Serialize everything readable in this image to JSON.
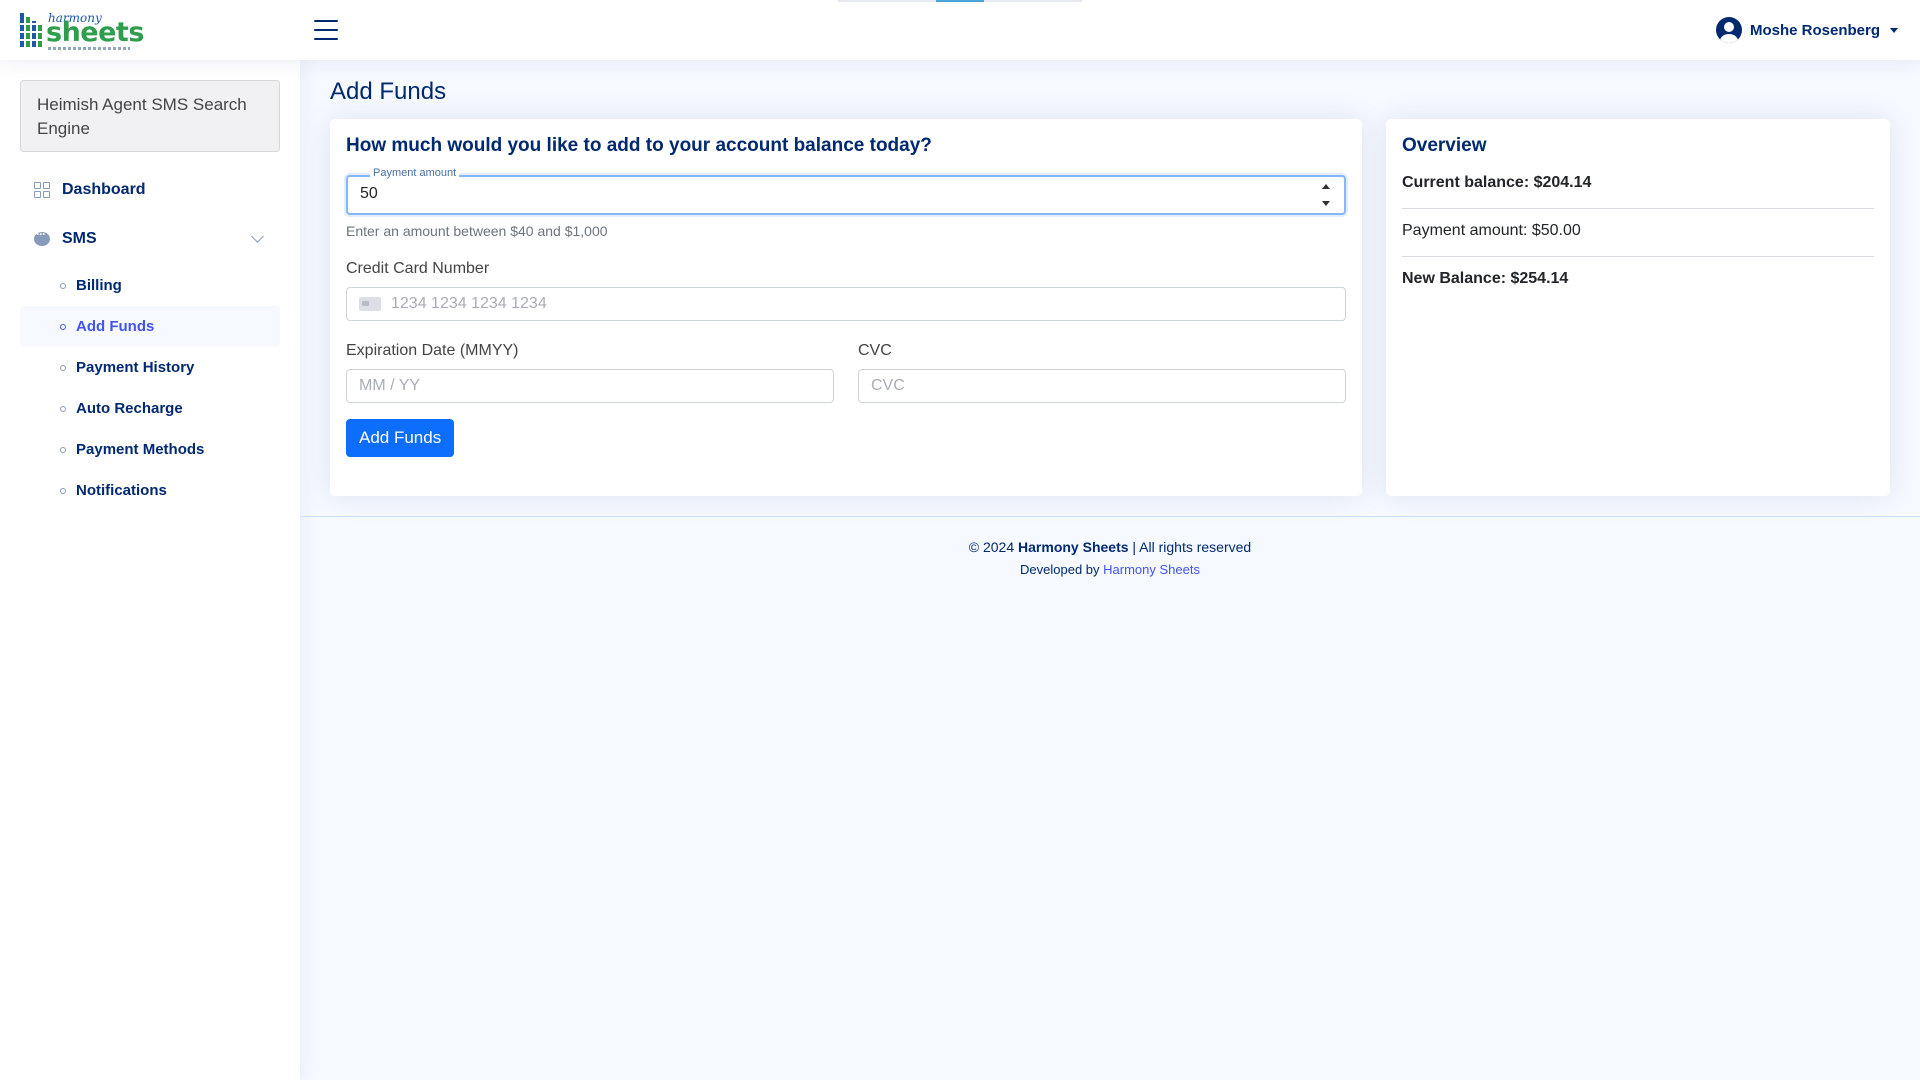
{
  "header": {
    "logo": {
      "small": "harmony",
      "big": "sheets"
    },
    "user_name": "Moshe Rosenberg"
  },
  "sidebar": {
    "app_name": "Heimish Agent SMS Search Engine",
    "items": [
      {
        "label": "Dashboard",
        "icon": "grid-icon"
      },
      {
        "label": "SMS",
        "icon": "chat-icon",
        "expanded": true
      }
    ],
    "sms_children": [
      {
        "label": "Billing"
      },
      {
        "label": "Add Funds",
        "active": true
      },
      {
        "label": "Payment History"
      },
      {
        "label": "Auto Recharge"
      },
      {
        "label": "Payment Methods"
      },
      {
        "label": "Notifications"
      }
    ]
  },
  "main": {
    "page_title": "Add Funds",
    "form": {
      "question": "How much would you like to add to your account balance today?",
      "amount_label": "Payment amount",
      "amount_value": "50",
      "amount_help": "Enter an amount between $40 and $1,000",
      "cc_label": "Credit Card Number",
      "cc_placeholder": "1234 1234 1234 1234",
      "exp_label": "Expiration Date (MMYY)",
      "exp_placeholder": "MM / YY",
      "cvc_label": "CVC",
      "cvc_placeholder": "CVC",
      "submit_label": "Add Funds"
    },
    "overview": {
      "title": "Overview",
      "current_balance": "Current balance: $204.14",
      "payment_amount": "Payment amount: $50.00",
      "new_balance": "New Balance: $254.14"
    }
  },
  "footer": {
    "copyright_prefix": "© 2024",
    "brand": "Harmony Sheets",
    "rights": "| All rights reserved",
    "developed_by": "Developed by",
    "developer": "Harmony Sheets"
  },
  "colors": {
    "primary": "#0d6efd",
    "navy": "#012970",
    "background": "#f6f9ff",
    "logo_green": "#2e9e4d"
  }
}
